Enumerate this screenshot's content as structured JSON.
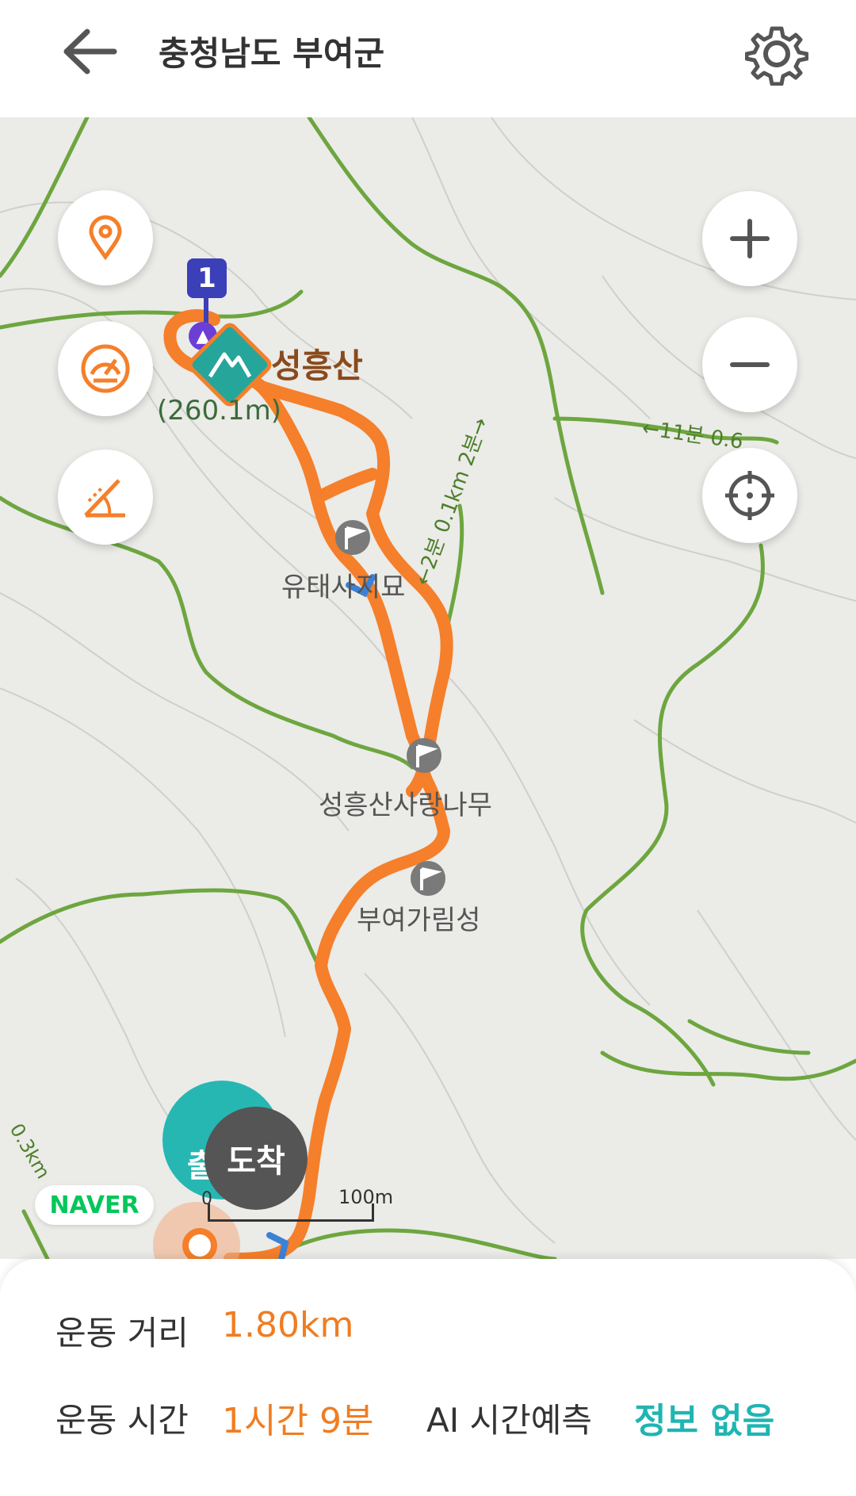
{
  "header": {
    "title": "충청남도 부여군",
    "back_icon": "arrow-left-icon",
    "settings_icon": "gear-icon"
  },
  "map": {
    "labels": {
      "peak_name": "성흥산",
      "elevation": "(260.1m)",
      "poi_1": "유태사지묘",
      "poi_2": "성흥산사랑나무",
      "poi_3": "부여가림성",
      "trail_time_1": "←11분 0.6",
      "trail_time_2": "←2분 0.1km 2분→",
      "trail_left": "0.3km"
    },
    "marker_number": "1",
    "arrival_label": "도착",
    "start_label": "출",
    "scale": {
      "zero": "0",
      "hundred": "100m"
    },
    "brand": "NAVER",
    "controls": [
      "location-pin-icon",
      "speedometer-icon",
      "slope-icon",
      "zoom-in-icon",
      "zoom-out-icon",
      "recenter-icon"
    ],
    "colors": {
      "route": "#f57f2a",
      "trail": "#6da63f",
      "map_bg": "#ebebe8"
    }
  },
  "stats": {
    "distance_label": "운동 거리",
    "distance_value": "1.80km",
    "time_label": "운동 시간",
    "time_value": "1시간 9분",
    "ai_label": "AI 시간예측",
    "ai_value": "정보 없음"
  }
}
